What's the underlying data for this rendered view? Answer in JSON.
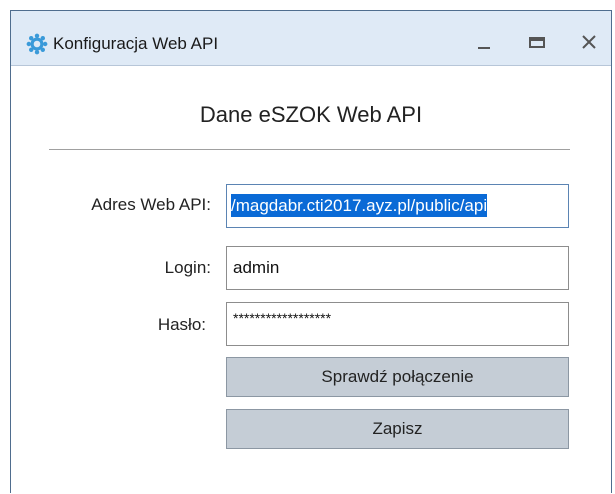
{
  "window": {
    "title": "Konfiguracja Web API",
    "controls": {
      "minimize": "_",
      "maximize": "▬",
      "close": "X"
    }
  },
  "form": {
    "heading": "Dane eSZOK Web API",
    "api_address": {
      "label": "Adres Web API:",
      "value": "/magdabr.cti2017.ayz.pl/public/api"
    },
    "login": {
      "label": "Login:",
      "value": "admin"
    },
    "password": {
      "label": "Hasło:",
      "value": "******************"
    },
    "check_button_label": "Sprawdź połączenie",
    "save_button_label": "Zapisz"
  },
  "colors": {
    "titlebar": "#dfeaf6",
    "selection": "#0a6ad6",
    "button": "#c5cdd6"
  },
  "icons": {
    "app": "gear-sun-icon"
  }
}
